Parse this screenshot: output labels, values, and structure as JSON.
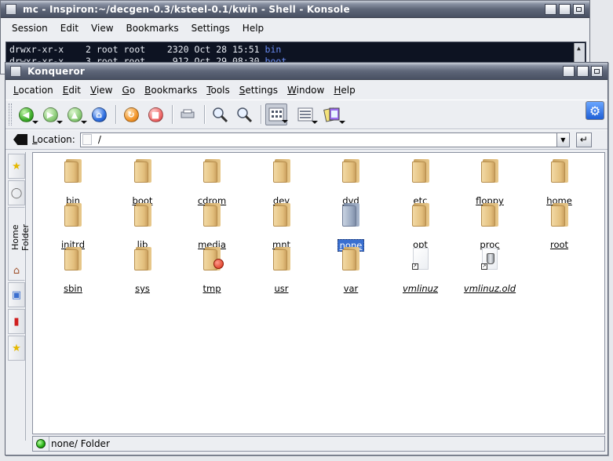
{
  "konsole": {
    "title": "mc - Inspiron:~/decgen-0.3/ksteel-0.1/kwin - Shell - Konsole",
    "menu": [
      "Session",
      "Edit",
      "View",
      "Bookmarks",
      "Settings",
      "Help"
    ],
    "lines": [
      {
        "perm": "drwxr-xr-x",
        "links": "2",
        "owner": "root",
        "group": "root",
        "size": "2320",
        "date": "Oct 28 15:51",
        "name": "bin"
      },
      {
        "perm": "drwxr-xr-x",
        "links": "3",
        "owner": "root",
        "group": "root",
        "size": "912",
        "date": "Oct 29 08:30",
        "name": "boot"
      }
    ]
  },
  "konqueror": {
    "title": "Konqueror",
    "menu": [
      {
        "accel": "L",
        "rest": "ocation"
      },
      {
        "accel": "E",
        "rest": "dit"
      },
      {
        "accel": "V",
        "rest": "iew"
      },
      {
        "accel": "G",
        "rest": "o"
      },
      {
        "accel": "B",
        "rest": "ookmarks"
      },
      {
        "accel": "T",
        "rest": "ools"
      },
      {
        "accel": "S",
        "rest": "ettings"
      },
      {
        "accel": "W",
        "rest": "indow"
      },
      {
        "accel": "H",
        "rest": "elp"
      }
    ],
    "location": {
      "label_accel": "L",
      "label_rest": "ocation:",
      "value": "/"
    },
    "sidebar": {
      "home_label": "Home Folder"
    },
    "files": [
      {
        "name": "bin",
        "kind": "folder"
      },
      {
        "name": "boot",
        "kind": "folder"
      },
      {
        "name": "cdrom",
        "kind": "folder"
      },
      {
        "name": "dev",
        "kind": "folder"
      },
      {
        "name": "dvd",
        "kind": "folder"
      },
      {
        "name": "etc",
        "kind": "folder"
      },
      {
        "name": "floppy",
        "kind": "folder"
      },
      {
        "name": "home",
        "kind": "folder"
      },
      {
        "name": "initrd",
        "kind": "folder"
      },
      {
        "name": "lib",
        "kind": "folder"
      },
      {
        "name": "media",
        "kind": "folder"
      },
      {
        "name": "mnt",
        "kind": "folder"
      },
      {
        "name": "none",
        "kind": "folder-selected"
      },
      {
        "name": "opt",
        "kind": "folder"
      },
      {
        "name": "proc",
        "kind": "folder"
      },
      {
        "name": "root",
        "kind": "folder"
      },
      {
        "name": "sbin",
        "kind": "folder"
      },
      {
        "name": "sys",
        "kind": "folder"
      },
      {
        "name": "tmp",
        "kind": "folder-badge"
      },
      {
        "name": "usr",
        "kind": "folder"
      },
      {
        "name": "var",
        "kind": "folder"
      },
      {
        "name": "vmlinuz",
        "kind": "link-file"
      },
      {
        "name": "vmlinuz.old",
        "kind": "link-file-can"
      }
    ],
    "status": "none/  Folder"
  },
  "icons": {
    "back": "back-arrow-icon",
    "forward": "forward-arrow-icon",
    "up": "up-arrow-icon",
    "home": "home-icon",
    "reload": "reload-icon",
    "stop": "stop-icon",
    "print": "print-icon",
    "zoom_in": "zoom-in-icon",
    "zoom_out": "zoom-out-icon",
    "icon_view": "icon-view-icon",
    "detail_view": "detail-view-icon",
    "view_profile": "view-profile-icon",
    "konq_gear": "konqueror-gear-icon"
  }
}
